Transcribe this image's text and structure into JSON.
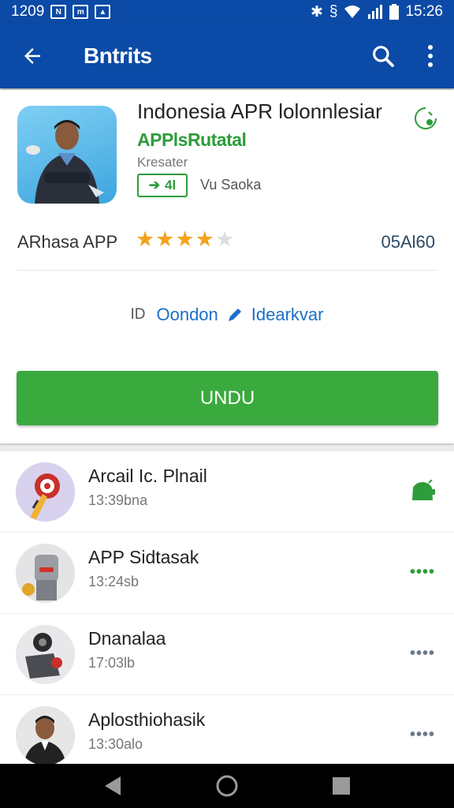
{
  "status_bar": {
    "time_left": "1209",
    "time_right": "15:26"
  },
  "app_bar": {
    "title": "Bntrits"
  },
  "app": {
    "name": "Indonesia APR lolonnlesiar",
    "developer": "APPlsRutatal",
    "category": "Kresater",
    "badge_label": "Vu Saoka",
    "badge_text": "4l",
    "rating_label": "ARhasa APP",
    "rating_stars": 4,
    "rating_max": 5,
    "rating_value": "05Al60",
    "info_prefix": "ID",
    "info_link_1": "Oondon",
    "info_link_2": "Idearkvar",
    "install_label": "UNDU"
  },
  "related_apps": [
    {
      "title": "Arcail Ic.   Plnail",
      "subtitle": "13:39bna",
      "action": "install"
    },
    {
      "title": "APP Sidtasak",
      "subtitle": "13:24sb",
      "action": "more"
    },
    {
      "title": "Dnanalaa",
      "subtitle": "17:03lb",
      "action": "more"
    },
    {
      "title": "Aplosthiohasik",
      "subtitle": "13:30alo",
      "action": "more"
    }
  ],
  "colors": {
    "primary": "#0b4aa6",
    "accent_green": "#3aaa3e",
    "star": "#f4a21a"
  },
  "icons": [
    "back-arrow-icon",
    "search-icon",
    "more-vert-icon",
    "install-state-icon",
    "android-icon",
    "more-horiz-icon",
    "nav-back-icon",
    "nav-home-icon",
    "nav-recents-icon"
  ]
}
